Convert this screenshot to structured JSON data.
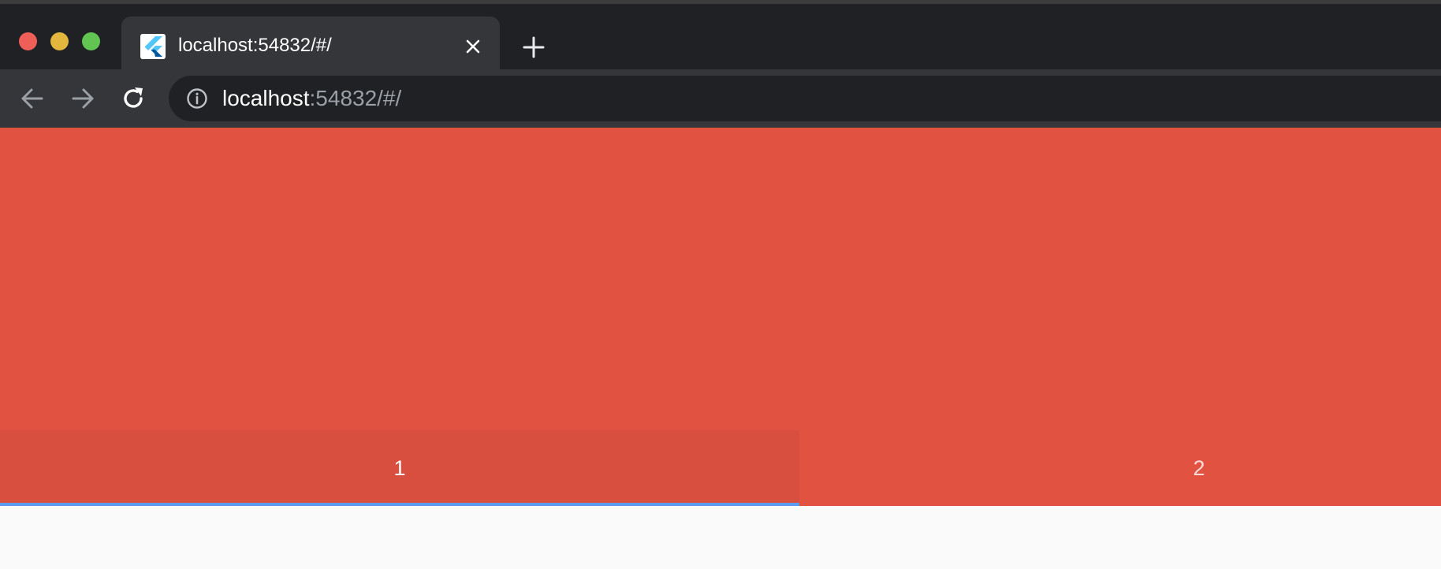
{
  "browser": {
    "window_controls": {
      "close_color": "#ed5f57",
      "minimize_color": "#e3b73e",
      "maximize_color": "#62c453"
    },
    "tab": {
      "title": "localhost:54832/#/",
      "favicon": "flutter-logo-icon"
    },
    "address_bar": {
      "host": "localhost",
      "rest": ":54832/#/"
    },
    "icons": {
      "back": "arrow-left-icon",
      "forward": "arrow-right-icon",
      "reload": "reload-icon",
      "info": "info-icon",
      "close_tab": "close-icon",
      "new_tab": "plus-icon"
    }
  },
  "app": {
    "accent_color": "#e15241",
    "indicator_color": "#5b9bf0",
    "tabs": [
      {
        "label": "1",
        "selected": true
      },
      {
        "label": "2",
        "selected": false
      }
    ]
  }
}
